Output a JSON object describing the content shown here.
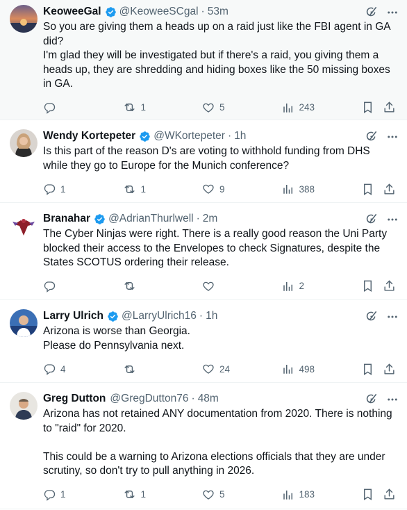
{
  "replies": [
    {
      "name": "KeoweeGal",
      "handle": "@KeoweeSCgal",
      "time": "53m",
      "text": "So you are giving them a heads up on a raid just like the FBI agent in GA did?\nI'm glad they will be investigated but if there's a raid, you giving them a heads up, they are shredding and hiding boxes like the 50 missing boxes in GA.",
      "replies": "",
      "reposts": "1",
      "likes": "5",
      "views": "243"
    },
    {
      "name": "Wendy Kortepeter",
      "handle": "@WKortepeter",
      "time": "1h",
      "text": "Is this part of the reason D's are voting to withhold funding from DHS while they go to Europe for the Munich conference?",
      "replies": "1",
      "reposts": "1",
      "likes": "9",
      "views": "388"
    },
    {
      "name": "Branahar",
      "handle": "@AdrianThurlwell",
      "time": "2m",
      "text": "The Cyber Ninjas were right. There is a really good reason the Uni Party blocked their access to the Envelopes to check Signatures, despite the States SCOTUS ordering their release.",
      "replies": "",
      "reposts": "",
      "likes": "",
      "views": "2"
    },
    {
      "name": "Larry Ulrich",
      "handle": "@LarryUlrich16",
      "time": "1h",
      "text": "Arizona is worse than Georgia.\nPlease do Pennsylvania next.",
      "replies": "4",
      "reposts": "",
      "likes": "24",
      "views": "498"
    },
    {
      "name": "Greg Dutton",
      "handle": "@GregDutton76",
      "time": "48m",
      "text": "Arizona has not retained ANY documentation from 2020. There is nothing to \"raid\" for 2020.\n\nThis could be a warning to Arizona elections officials that they are under scrutiny, so don't try to pull anything in 2026.",
      "replies": "1",
      "reposts": "1",
      "likes": "5",
      "views": "183"
    }
  ],
  "separator": "·",
  "colors": {
    "verified": "#1d9bf0",
    "muted": "#536471",
    "text": "#0f1419",
    "highlight_bg": "#f7f9f9"
  },
  "icons": [
    "verified-badge-icon",
    "grok-icon",
    "more-icon",
    "reply-icon",
    "repost-icon",
    "like-icon",
    "views-icon",
    "bookmark-icon",
    "share-icon"
  ]
}
